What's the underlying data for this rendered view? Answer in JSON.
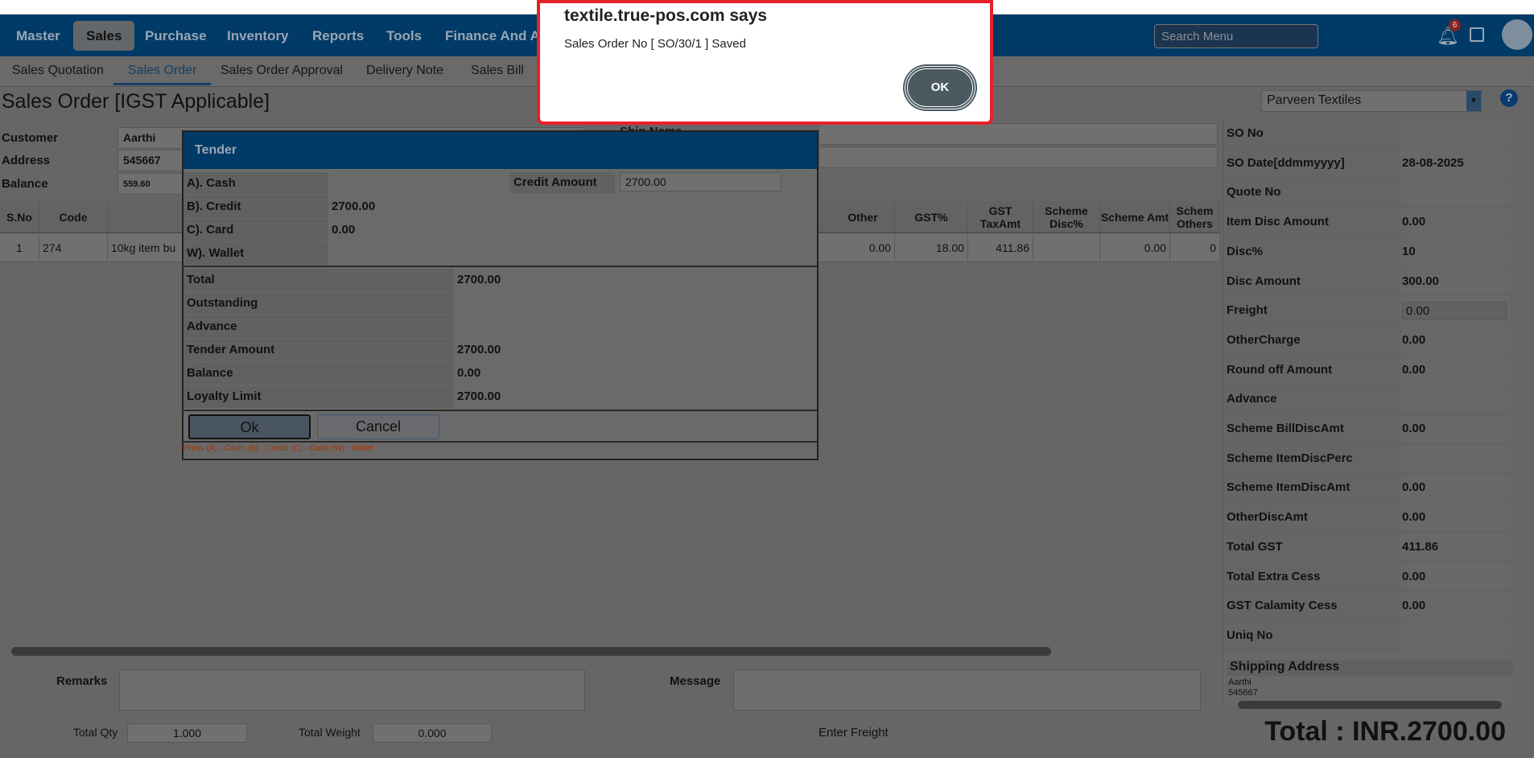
{
  "nav": {
    "items": [
      "Master",
      "Sales",
      "Purchase",
      "Inventory",
      "Reports",
      "Tools",
      "Finance And Ac"
    ],
    "active": "Sales",
    "search_placeholder": "Search Menu",
    "notif_count": "6"
  },
  "subnav": {
    "items": [
      "Sales Quotation",
      "Sales Order",
      "Sales Order Approval",
      "Delivery Note",
      "Sales Bill"
    ],
    "active": "Sales Order"
  },
  "page_title": "Sales Order [IGST Applicable]",
  "company": "Parveen Textiles",
  "header_fields": {
    "customer_label": "Customer",
    "customer": "Aarthi",
    "address_label": "Address",
    "address": "545667",
    "balance_label": "Balance",
    "balance": "559.60",
    "ship_name_label": "Ship Name"
  },
  "grid": {
    "headers": {
      "sno": "S.No",
      "code": "Code",
      "other": "Other",
      "gst": "GST%",
      "gst_tax": "GST TaxAmt",
      "scheme_disc": "Scheme Disc%",
      "scheme_amt": "Scheme Amt",
      "scheme_others": "Schem Others"
    },
    "row": {
      "sno": "1",
      "code": "274",
      "name": "10kg item bu",
      "other": "0.00",
      "gst": "18.00",
      "gst_tax": "411.86",
      "scheme_disc": "",
      "scheme_amt": "0.00",
      "scheme_others": "0"
    }
  },
  "summary": [
    {
      "label": "SO No",
      "value": ""
    },
    {
      "label": "SO Date[ddmmyyyy]",
      "value": "28-08-2025"
    },
    {
      "label": "Quote No",
      "value": ""
    },
    {
      "label": "Item Disc Amount",
      "value": "0.00"
    },
    {
      "label": "Disc%",
      "value": "10"
    },
    {
      "label": "Disc Amount",
      "value": "300.00"
    },
    {
      "label": "Freight",
      "value": "0.00"
    },
    {
      "label": "OtherCharge",
      "value": "0.00"
    },
    {
      "label": "Round off Amount",
      "value": "0.00"
    },
    {
      "label": "Advance",
      "value": ""
    },
    {
      "label": "Scheme BillDiscAmt",
      "value": "0.00"
    },
    {
      "label": "Scheme ItemDiscPerc",
      "value": ""
    },
    {
      "label": "Scheme ItemDiscAmt",
      "value": "0.00"
    },
    {
      "label": "OtherDiscAmt",
      "value": "0.00"
    },
    {
      "label": "Total GST",
      "value": "411.86"
    },
    {
      "label": "Total Extra Cess",
      "value": "0.00"
    },
    {
      "label": "GST Calamity Cess",
      "value": "0.00"
    },
    {
      "label": "Uniq No",
      "value": ""
    }
  ],
  "shipping": {
    "title": "Shipping Address",
    "line1": "Aarthi",
    "line2": "545667"
  },
  "footer": {
    "remarks_label": "Remarks",
    "message_label": "Message",
    "total_qty_label": "Total Qty",
    "total_qty": "1.000",
    "total_weight_label": "Total Weight",
    "total_weight": "0.000",
    "enter_freight_label": "Enter Freight",
    "grand_total": "Total : INR.2700.00"
  },
  "tender": {
    "title": "Tender",
    "pay": [
      {
        "label": "A). Cash",
        "value": ""
      },
      {
        "label": "B). Credit",
        "value": "2700.00"
      },
      {
        "label": "C). Card",
        "value": "0.00"
      },
      {
        "label": "W). Wallet",
        "value": ""
      }
    ],
    "credit_amount_label": "Credit Amount",
    "credit_amount": "2700.00",
    "totals": [
      {
        "label": "Total",
        "value": "2700.00"
      },
      {
        "label": "Outstanding",
        "value": ""
      },
      {
        "label": "Advance",
        "value": ""
      },
      {
        "label": "Tender Amount",
        "value": "2700.00"
      },
      {
        "label": "Balance",
        "value": "0.00"
      },
      {
        "label": "Loyalty Limit",
        "value": "2700.00"
      }
    ],
    "ok": "Ok",
    "cancel": "Cancel",
    "hint": "Press (A) - Cash; (B) - Credit; (C) - Card; (W) - Wallet"
  },
  "alert": {
    "title": "textile.true-pos.com says",
    "message": "Sales Order No [ SO/30/1 ] Saved",
    "ok": "OK"
  }
}
